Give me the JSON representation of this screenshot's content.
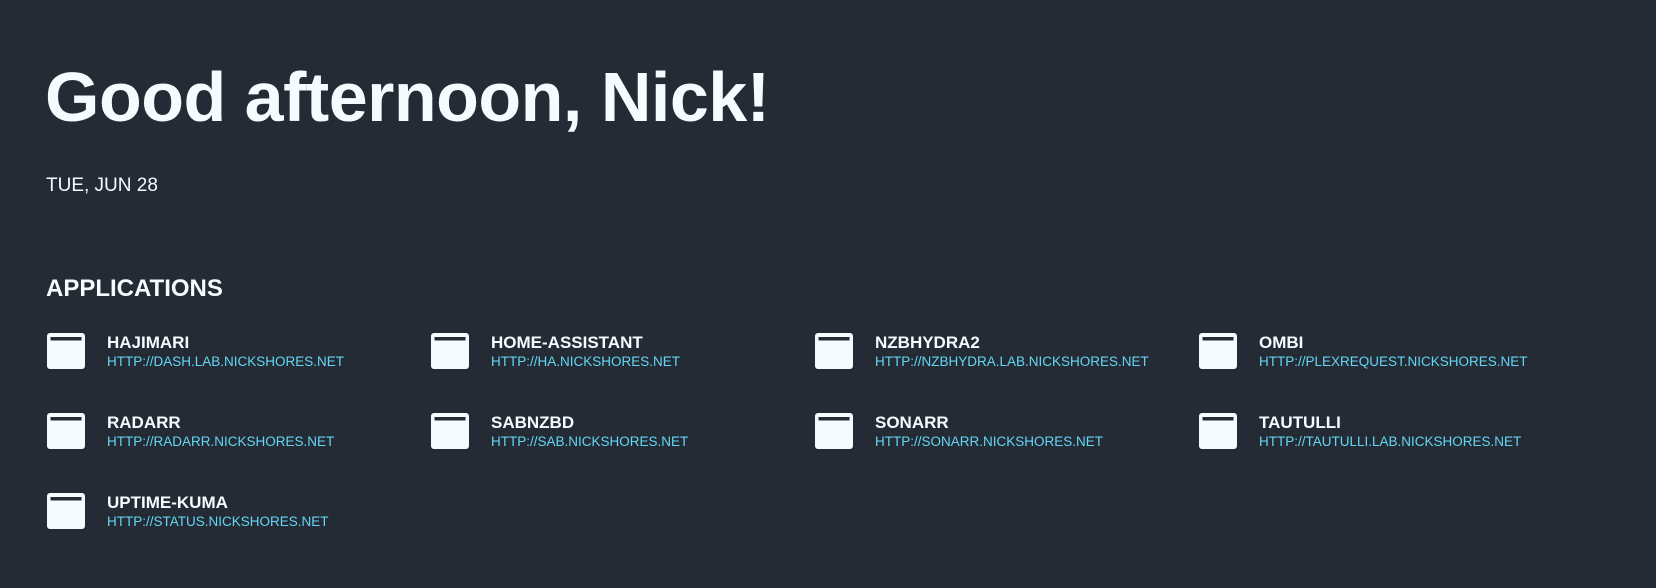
{
  "greeting": "Good afternoon, Nick!",
  "date": "TUE, JUN 28",
  "applications": {
    "title": "APPLICATIONS",
    "icon_name": "application-window-icon",
    "items": [
      {
        "name": "HAJIMARI",
        "url": "HTTP://DASH.LAB.NICKSHORES.NET"
      },
      {
        "name": "HOME-ASSISTANT",
        "url": "HTTP://HA.NICKSHORES.NET"
      },
      {
        "name": "NZBHYDRA2",
        "url": "HTTP://NZBHYDRA.LAB.NICKSHORES.NET"
      },
      {
        "name": "OMBI",
        "url": "HTTP://PLEXREQUEST.NICKSHORES.NET"
      },
      {
        "name": "RADARR",
        "url": "HTTP://RADARR.NICKSHORES.NET"
      },
      {
        "name": "SABNZBD",
        "url": "HTTP://SAB.NICKSHORES.NET"
      },
      {
        "name": "SONARR",
        "url": "HTTP://SONARR.NICKSHORES.NET"
      },
      {
        "name": "TAUTULLI",
        "url": "HTTP://TAUTULLI.LAB.NICKSHORES.NET"
      },
      {
        "name": "UPTIME-KUMA",
        "url": "HTTP://STATUS.NICKSHORES.NET"
      }
    ]
  },
  "colors": {
    "background": "#252b35",
    "text": "#f5fbff",
    "link": "#63d6f4"
  }
}
